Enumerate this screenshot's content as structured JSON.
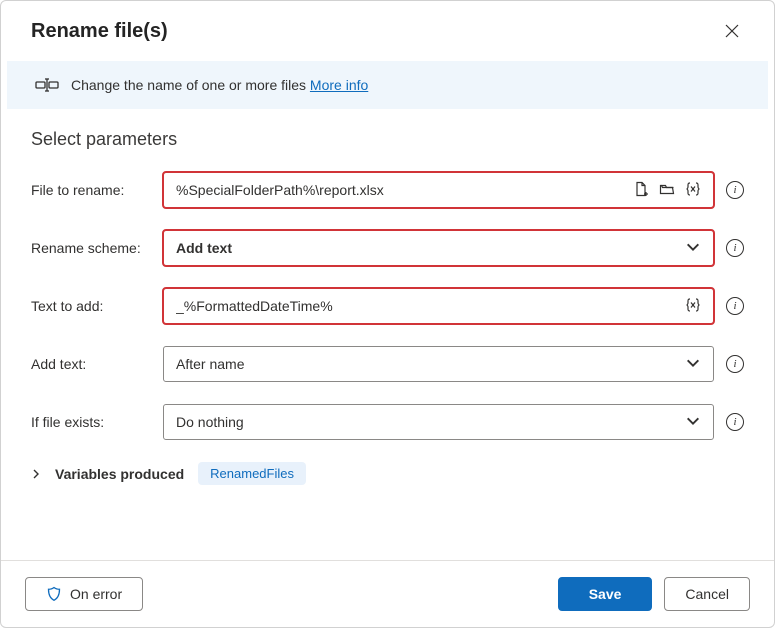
{
  "header": {
    "title": "Rename file(s)"
  },
  "infobar": {
    "text": "Change the name of one or more files ",
    "link": "More info"
  },
  "section_title": "Select parameters",
  "fields": {
    "file_to_rename": {
      "label": "File to rename:",
      "value": "%SpecialFolderPath%\\report.xlsx"
    },
    "rename_scheme": {
      "label": "Rename scheme:",
      "value": "Add text"
    },
    "text_to_add": {
      "label": "Text to add:",
      "value": "_%FormattedDateTime%"
    },
    "add_text": {
      "label": "Add text:",
      "value": "After name"
    },
    "if_exists": {
      "label": "If file exists:",
      "value": "Do nothing"
    }
  },
  "variables": {
    "label": "Variables produced",
    "chip": "RenamedFiles"
  },
  "footer": {
    "on_error": "On error",
    "save": "Save",
    "cancel": "Cancel"
  }
}
